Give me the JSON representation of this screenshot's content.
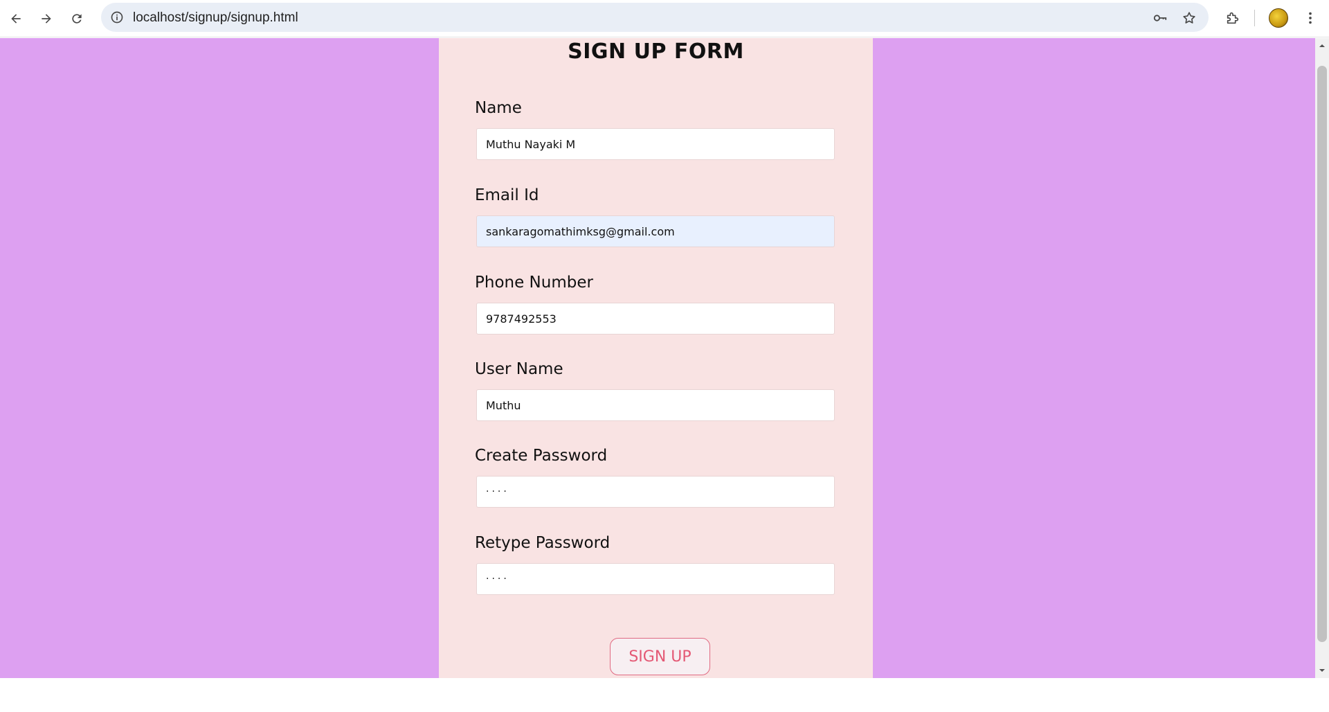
{
  "browser": {
    "url": "localhost/signup/signup.html",
    "icons": [
      "back-arrow-icon",
      "forward-arrow-icon",
      "reload-icon",
      "site-info-icon",
      "password-key-icon",
      "bookmark-star-icon",
      "extensions-icon",
      "profile-avatar",
      "more-menu-icon"
    ]
  },
  "form": {
    "title": "SIGN UP FORM",
    "fields": [
      {
        "label": "Name",
        "value": "Muthu Nayaki M"
      },
      {
        "label": "Email Id",
        "value": "sankaragomathimksg@gmail.com"
      },
      {
        "label": "Phone Number",
        "value": "9787492553"
      },
      {
        "label": "User Name",
        "value": "Muthu"
      },
      {
        "label": "Create Password",
        "value": "····"
      },
      {
        "label": "Retype Password",
        "value": "····"
      }
    ],
    "submit_label": "SIGN UP"
  },
  "colors": {
    "page_background": "#dda0f1",
    "panel_background": "#f9e3e3",
    "autofill_background": "#e8f0fe",
    "button_text": "#e45874",
    "button_border": "#e06a82"
  }
}
